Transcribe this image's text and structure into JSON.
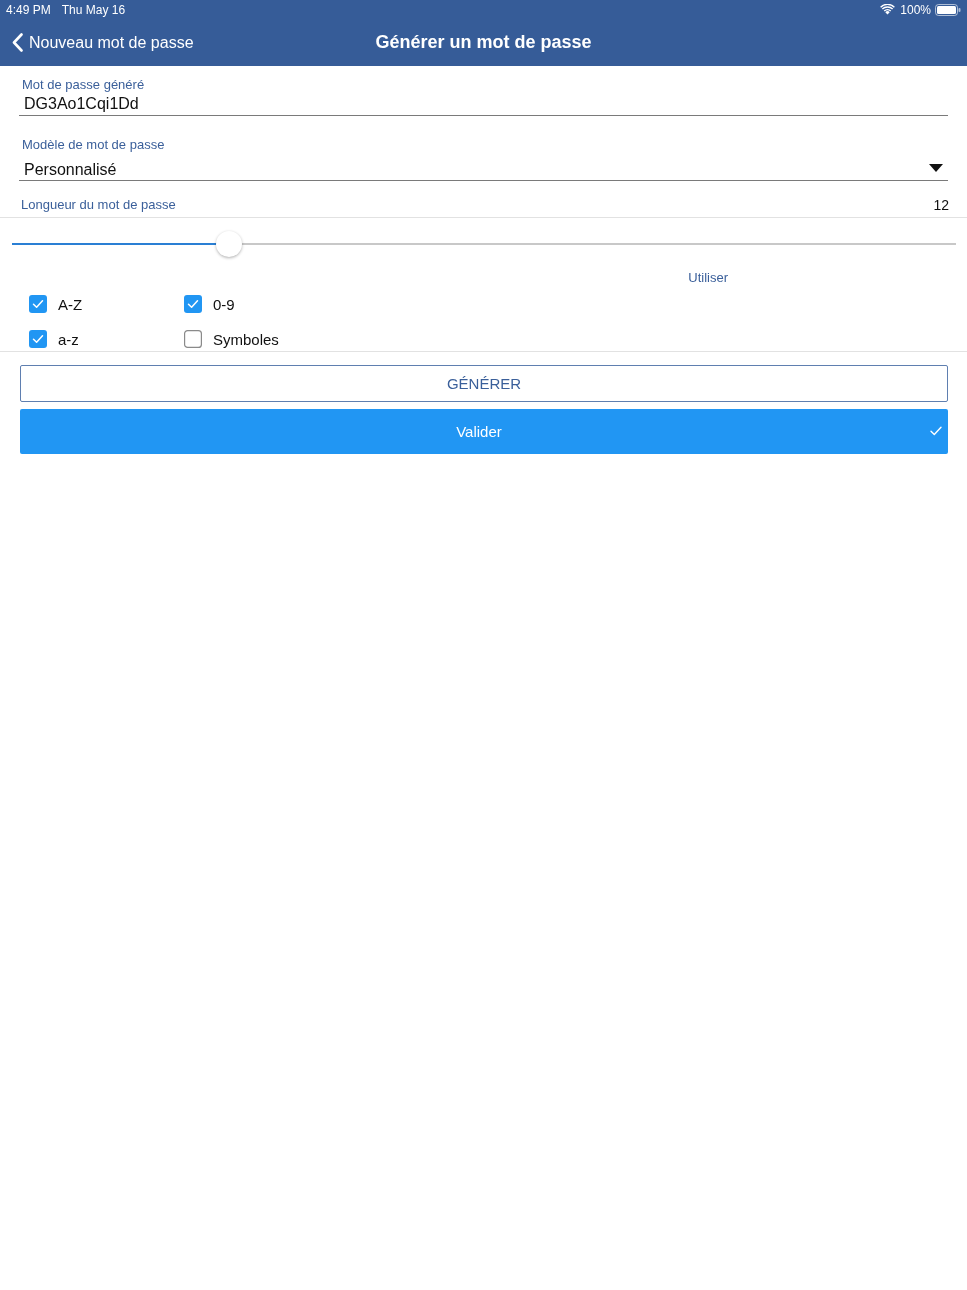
{
  "status_bar": {
    "time": "4:49 PM",
    "date": "Thu May 16",
    "battery": "100%"
  },
  "nav_bar": {
    "back": "Nouveau mot de passe",
    "title": "Générer un mot de passe"
  },
  "fields": [
    {
      "kind": "text",
      "label": "Mot de passe généré",
      "value": "DG3Ao1Cqi1Dd"
    },
    {
      "kind": "dropdown",
      "label": "Modèle de mot de passe",
      "value": "Personnalisé"
    }
  ],
  "length": {
    "label": "Longueur du mot de passe",
    "value": "12",
    "level": 0.23
  },
  "options": {
    "heading": "Utiliser",
    "checkboxes": [
      {
        "label": "A-Z",
        "checked": true
      },
      {
        "label": "0-9",
        "checked": true
      },
      {
        "label": "a-z",
        "checked": true
      },
      {
        "label": "Symboles",
        "checked": false
      }
    ]
  },
  "buttons": [
    {
      "kind": "outline",
      "label": "GÉNÉRER"
    },
    {
      "kind": "primary",
      "label": "Valider"
    }
  ]
}
